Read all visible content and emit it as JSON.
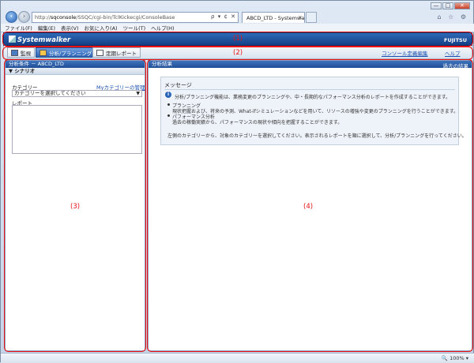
{
  "browser": {
    "address_prefix": "http://",
    "address_host": "sqconsole",
    "address_path": "/SSQC/cgi-bin/TclKickecgi/ConsoleBase",
    "address_tools": "ρ ▾ ¢ ✕",
    "tab_title": "ABCD_LTD - Systemwal...",
    "window_buttons": [
      "—",
      "□",
      "✕"
    ],
    "right_icons": "⌂ ☆ ⚙",
    "menu": [
      "ファイル(F)",
      "編集(E)",
      "表示(V)",
      "お気に入り(A)",
      "ツール(T)",
      "ヘルプ(H)"
    ],
    "zoom": "🔍 100%  ▾"
  },
  "header": {
    "logo": "Systemwalker",
    "brand": "FUJITSU"
  },
  "toolbar": {
    "monitor": "監視",
    "analysis": "分析/プランニング",
    "report": "定期レポート",
    "console_def": "コンソール定義編集",
    "help": "ヘルプ"
  },
  "left_panel": {
    "title": "分析条件 － ABCD_LTD",
    "section": "▼ シナリオ",
    "category_label": "カテゴリー",
    "my_category_link": "Myカテゴリーの管理",
    "category_select": "カテゴリーを選択してください",
    "report_label": "レポート"
  },
  "right_panel": {
    "title": "分析結果",
    "history_link": "過去の結果",
    "message_title": "メッセージ",
    "intro": "分析/プランニング機能は、業務変更のプランニングや、中・長期的なパフォーマンス分析のレポートを作成することができます。",
    "b1_title": "プランニング",
    "b1_text": "現状把握および、将来の予測、What-ifシミュレーションなどを用いて、リソースの増強や変更のプランニングを行うことができます。",
    "b2_title": "パフォーマンス分析",
    "b2_text": "過去の稼働実績から、パフォーマンスの現状や傾向を把握することができます。",
    "footer": "左側のカテゴリーから、対象のカテゴリーを選択してください。表示されるレポートを順に選択して、分析/プランニングを行ってください。"
  },
  "callouts": [
    "(1)",
    "(2)",
    "(3)",
    "(4)"
  ],
  "colors": {
    "accent": "#1f4e96",
    "callout": "#e11111",
    "link": "#1a4fb0"
  }
}
